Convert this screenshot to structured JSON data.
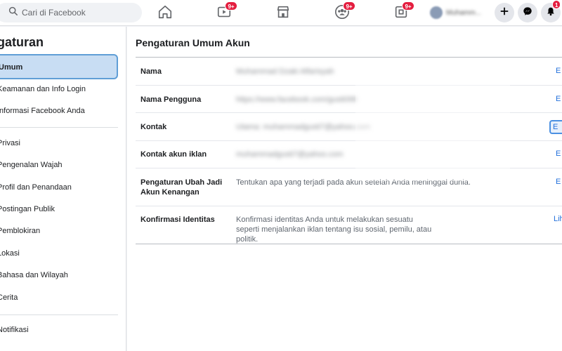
{
  "header": {
    "search_placeholder": "Cari di Facebook",
    "nav": [
      {
        "icon": "home-icon",
        "badge": ""
      },
      {
        "icon": "watch-icon",
        "badge": "9+"
      },
      {
        "icon": "marketplace-icon",
        "badge": ""
      },
      {
        "icon": "groups-icon",
        "badge": "9+"
      },
      {
        "icon": "gaming-icon",
        "badge": "9+"
      }
    ],
    "profile_name": "Muhamm...",
    "actions": [
      {
        "icon": "plus-icon",
        "badge": ""
      },
      {
        "icon": "messenger-icon",
        "badge": ""
      },
      {
        "icon": "bell-icon",
        "badge": "1"
      }
    ],
    "accent_color": "#1877f2",
    "badge_color": "#e41e3f"
  },
  "sidebar": {
    "title": "gaturan",
    "items": [
      {
        "label": "Umum",
        "active": true
      },
      {
        "label": "Keamanan dan Info Login"
      },
      {
        "label": "Informasi Facebook Anda"
      },
      {
        "label": "Privasi"
      },
      {
        "label": "Pengenalan Wajah"
      },
      {
        "label": "Profil dan Penandaan"
      },
      {
        "label": "Postingan Publik"
      },
      {
        "label": "Pemblokiran"
      },
      {
        "label": "Lokasi"
      },
      {
        "label": "Bahasa dan Wilayah"
      },
      {
        "label": "Cerita"
      },
      {
        "label": "Notifikasi"
      }
    ]
  },
  "main": {
    "title": "Pengaturan Umum Akun",
    "rows": [
      {
        "label": "Nama",
        "value": "Muhammad Dzaki Alfarisyah",
        "action": "E"
      },
      {
        "label": "Nama Pengguna",
        "value": "https://www.facebook.com/gusti099",
        "action": "E"
      },
      {
        "label": "Kontak",
        "value": "Utama: muhammadgusti7@yahoo.com",
        "action": "E"
      },
      {
        "label": "Kontak akun iklan",
        "value": "muhammadgusti7@yahoo.com",
        "action": "E"
      },
      {
        "label": "Pengaturan Ubah Jadi Akun Kenangan",
        "value": "Tentukan apa yang terjadi pada akun setelah Anda meninggal dunia.",
        "action": "E"
      },
      {
        "label": "Konfirmasi Identitas",
        "value": "Konfirmasi identitas Anda untuk melakukan sesuatu seperti menjalankan iklan tentang isu sosial, pemilu, atau politik.",
        "action": "Lih"
      }
    ]
  }
}
